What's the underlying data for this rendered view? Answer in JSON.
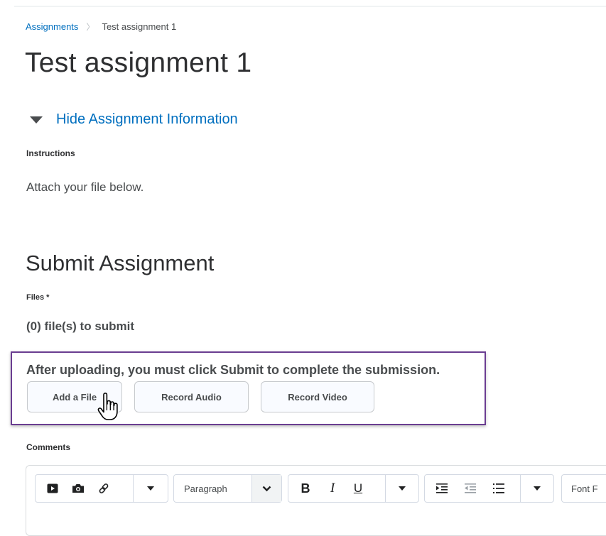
{
  "breadcrumb": {
    "parent": "Assignments",
    "separator": "〉",
    "current": "Test assignment 1"
  },
  "page": {
    "title": "Test assignment 1"
  },
  "info_toggle": {
    "label": "Hide Assignment Information"
  },
  "instructions": {
    "label": "Instructions",
    "text": "Attach your file below."
  },
  "submit": {
    "heading": "Submit Assignment",
    "files_label": "Files *",
    "file_count": "(0) file(s) to submit",
    "upload_message": "After uploading, you must click Submit to complete the submission.",
    "buttons": {
      "add_file": "Add a File",
      "record_audio": "Record Audio",
      "record_video": "Record Video"
    }
  },
  "comments": {
    "label": "Comments",
    "toolbar": {
      "paragraph": "Paragraph",
      "bold": "B",
      "italic": "I",
      "underline": "U",
      "font_family": "Font F",
      "icons": [
        "video-icon",
        "camera-icon",
        "link-icon",
        "caret-down-icon",
        "chevron-down-icon",
        "indent-icon",
        "outdent-icon",
        "list-icon"
      ]
    }
  },
  "colors": {
    "link": "#006fbf",
    "highlight_border": "#6a3d91",
    "text": "#494c4e",
    "heading": "#2e2f31"
  }
}
